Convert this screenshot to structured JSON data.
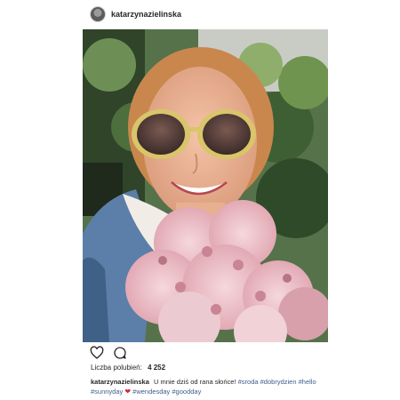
{
  "post": {
    "username": "katarzynazielinska",
    "likes_label": "Liczba polubień:",
    "likes_count": "4 252",
    "caption": {
      "username": "katarzynazielinska",
      "text": "U mnie dziś od rana słońce!",
      "tags": [
        "#sroda",
        "#dobrydzien",
        "#hello",
        "#sunnyday",
        "#wendesday",
        "#goodday"
      ],
      "emoji": "heart"
    }
  },
  "icons": {
    "like": "heart-outline-icon",
    "comment": "comment-bubble-icon"
  }
}
